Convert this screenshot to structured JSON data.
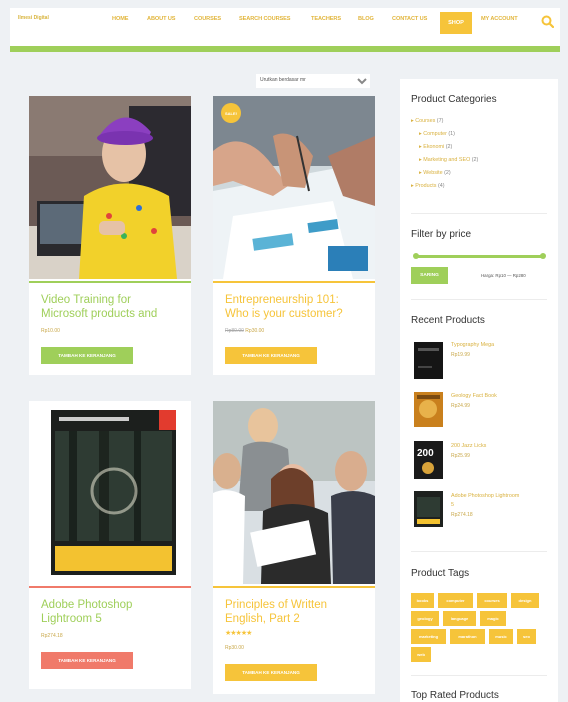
{
  "header": {
    "logo": "Ilmesi Digital",
    "nav": [
      "HOME",
      "ABOUT US",
      "COURSES",
      "SEARCH COURSES",
      "TEACHERS",
      "BLOG",
      "CONTACT US",
      "SHOP",
      "MY ACCOUNT"
    ],
    "active_nav": "SHOP",
    "accent": "#f6c43a",
    "strip_color": "#9fcf5a"
  },
  "sort": {
    "label": "Urutkan berdasar mr"
  },
  "products": [
    {
      "title": "Video Training for\nMicrosoft products and",
      "price": "Rp10.00",
      "button": "TAMBAH KE KERANJANG",
      "color": "#9fcf5a"
    },
    {
      "title": "Entrepreneurship 101:\nWho is your customer?",
      "old_price": "Rp80.00",
      "price": "Rp30.00",
      "button": "TAMBAH KE KERANJANG",
      "color": "#f6c43a",
      "badge": "SALE!"
    },
    {
      "title": "Adobe Photoshop\nLightroom 5",
      "price": "Rp274.18",
      "button": "TAMBAH KE KERANJANG",
      "color": "#f07a6a"
    },
    {
      "title": "Principles of Written\nEnglish, Part 2",
      "stars": "★★★★★",
      "price": "Rp30.00",
      "button": "TAMBAH KE KERANJANG",
      "color": "#f6c43a"
    }
  ],
  "sidebar": {
    "categories_title": "Product Categories",
    "categories": [
      {
        "name": "Courses",
        "count": "(7)",
        "indent": false
      },
      {
        "name": "Computer",
        "count": "(1)",
        "indent": true
      },
      {
        "name": "Ekonomi",
        "count": "(2)",
        "indent": true
      },
      {
        "name": "Marketing and SEO",
        "count": "(2)",
        "indent": true
      },
      {
        "name": "Website",
        "count": "(2)",
        "indent": true
      },
      {
        "name": "Products",
        "count": "(4)",
        "indent": false
      }
    ],
    "filter_title": "Filter by price",
    "filter_button": "SARING",
    "price_range": "Harga: Rp10 — Rp280",
    "recent_title": "Recent Products",
    "recent": [
      {
        "name": "Typography Mega",
        "price": "Rp19.99"
      },
      {
        "name": "Geology Fact Book",
        "price": "Rp24.99"
      },
      {
        "name": "200 Jazz Licks",
        "price": "Rp25.99"
      },
      {
        "name": "Adobe Photoshop Lightroom\n5",
        "price": "Rp274.18"
      }
    ],
    "tags_title": "Product Tags",
    "tags": [
      "books",
      "computer",
      "courses",
      "design",
      "geology",
      "language",
      "magic",
      "marketing",
      "marathon",
      "music",
      "seo",
      "web"
    ],
    "top_rated_title": "Top Rated Products"
  }
}
